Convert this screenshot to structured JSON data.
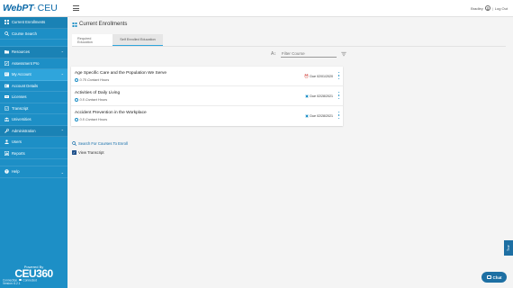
{
  "brand": {
    "logo_main": "WebPT",
    "logo_tm": "®",
    "logo_sub": "CEU"
  },
  "sidebar": {
    "items": [
      {
        "label": "Current Enrollments",
        "icon": "grid-icon",
        "type": "section"
      },
      {
        "label": "Course Search",
        "icon": "search-icon",
        "type": "item"
      },
      {
        "label": "Resources",
        "icon": "folder-icon",
        "type": "section"
      },
      {
        "label": "Assessment Pro",
        "icon": "edit-icon",
        "type": "item"
      },
      {
        "label": "My Account",
        "icon": "account-icon",
        "type": "active"
      },
      {
        "label": "Account Details",
        "icon": "id-card-icon",
        "type": "item"
      },
      {
        "label": "Licenses",
        "icon": "license-icon",
        "type": "item"
      },
      {
        "label": "Transcript",
        "icon": "transcript-icon",
        "type": "item"
      },
      {
        "label": "Universities",
        "icon": "university-icon",
        "type": "item"
      },
      {
        "label": "Administration",
        "icon": "wrench-icon",
        "type": "section"
      },
      {
        "label": "Users",
        "icon": "user-icon",
        "type": "item"
      },
      {
        "label": "Reports",
        "icon": "report-icon",
        "type": "item"
      },
      {
        "label": "Help",
        "icon": "help-icon",
        "type": "item"
      }
    ],
    "powered_by": "Powered By",
    "powered_logo": "CEU360",
    "status_line1_left": "Connection",
    "status_line1_right": "Connected",
    "status_line2": "Version: 6.2.1"
  },
  "header": {
    "user_name": "Bradley",
    "logout": "Log Out"
  },
  "main": {
    "page_title": "Current Enrollments",
    "tabs": [
      {
        "label": "Required Education",
        "active": false
      },
      {
        "label": "Self Enrolled Education",
        "active": true
      }
    ],
    "filter_placeholder": "Filter Course",
    "courses": [
      {
        "title": "Age Specific Care and the Population We Serve",
        "hours": "0.75 Contact Hours",
        "due": "Due 02/01/2020",
        "due_status": "overdue"
      },
      {
        "title": "Activities of Daily Living",
        "hours": "0.5 Contact Hours",
        "due": "Due 02/28/2021",
        "due_status": "upcoming"
      },
      {
        "title": "Accident Prevention in the Workplace",
        "hours": "0.5 Contact Hours",
        "due": "Due 02/28/2021",
        "due_status": "upcoming"
      }
    ],
    "search_link": "Search For Courses To Enroll",
    "view_transcript": "View Transcript",
    "side_tab": "Tour",
    "chat": "Chat"
  },
  "colors": {
    "sidebar": "#1d8fc6",
    "accent": "#2fa5dc",
    "brand": "#0d6aa8",
    "overdue": "#e5482a",
    "upcoming": "#1d8fc6"
  }
}
